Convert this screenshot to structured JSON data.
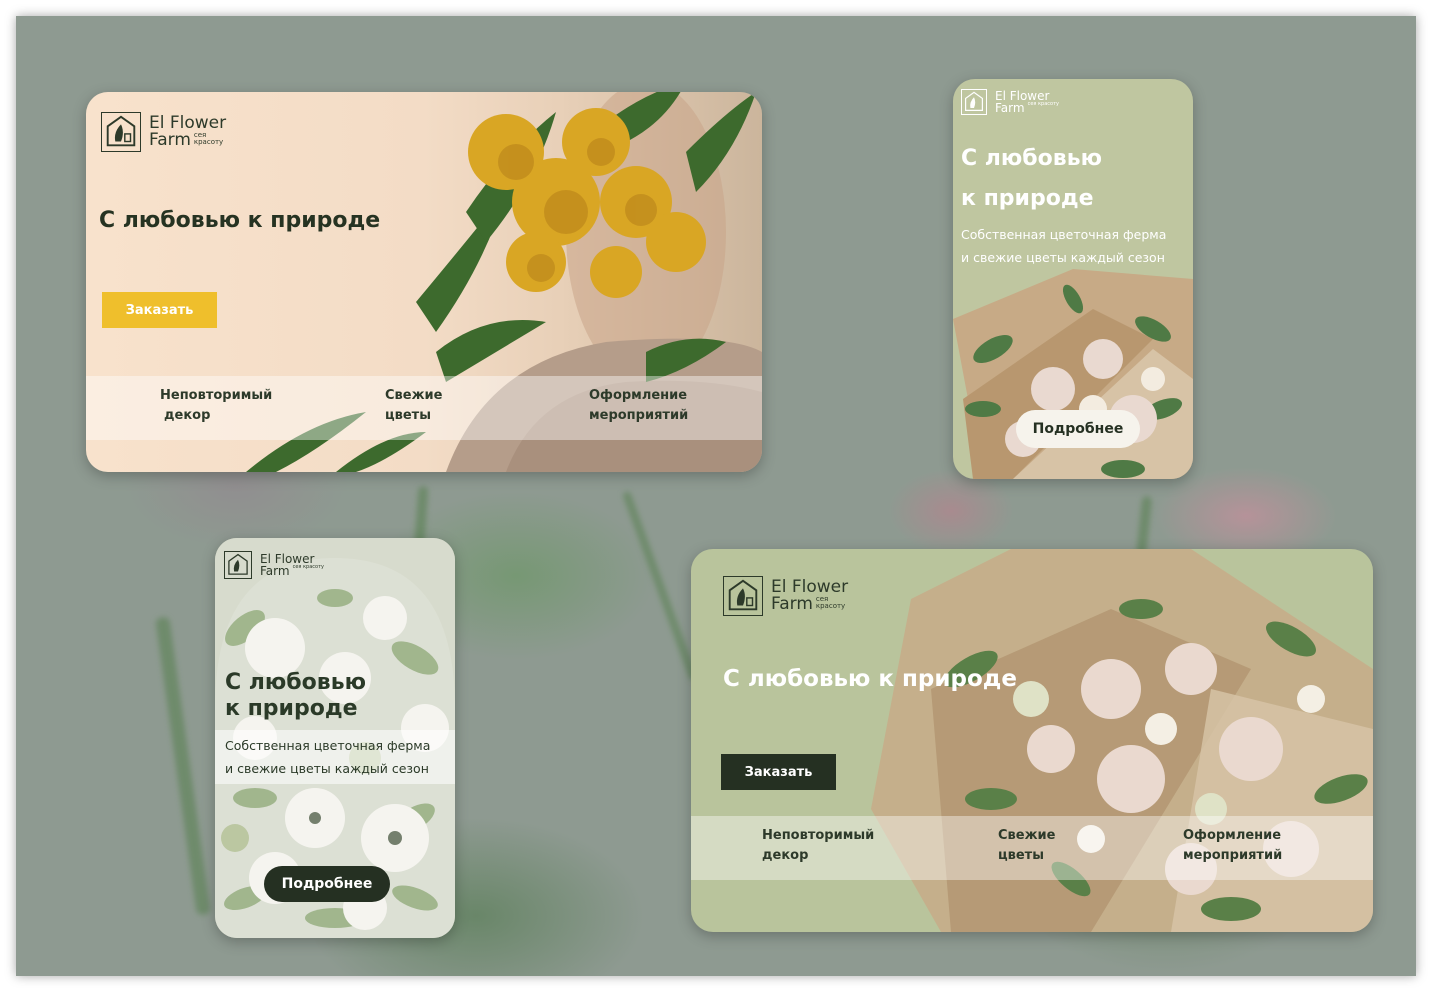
{
  "colors": {
    "backdrop": "#8e9a91",
    "accent_yellow": "#efbf2c",
    "dark_green": "#2b3a2c",
    "olive": "#bfc6a0",
    "peach": "#f6dfc9"
  },
  "logo": {
    "name_line1": "El Flower",
    "name_line2": "Farm",
    "tagline": "сея красоту",
    "icon": "flower-house-logo-icon"
  },
  "cards": {
    "card1": {
      "headline": "С любовью к природе",
      "button_label": "Заказать",
      "features": [
        {
          "line1": "Неповторимый",
          "line2": "декор"
        },
        {
          "line1": "Свежие",
          "line2": "цветы"
        },
        {
          "line1": "Оформление",
          "line2": "мероприятий"
        }
      ]
    },
    "card2": {
      "headline_line1": "С любовью",
      "headline_line2": "к природе",
      "subtitle_line1": "Собственная цветочная ферма",
      "subtitle_line2": "и свежие цветы каждый сезон",
      "button_label": "Подробнее"
    },
    "card3": {
      "headline_line1": "С любовью",
      "headline_line2": "к природе",
      "subtitle_line1": "Собственная цветочная ферма",
      "subtitle_line2": "и свежие цветы каждый сезон",
      "button_label": "Подробнее"
    },
    "card4": {
      "headline": "С любовью к природе",
      "button_label": "Заказать",
      "features": [
        {
          "line1": "Неповторимый",
          "line2": "декор"
        },
        {
          "line1": "Свежие",
          "line2": "цветы"
        },
        {
          "line1": "Оформление",
          "line2": "мероприятий"
        }
      ]
    }
  }
}
